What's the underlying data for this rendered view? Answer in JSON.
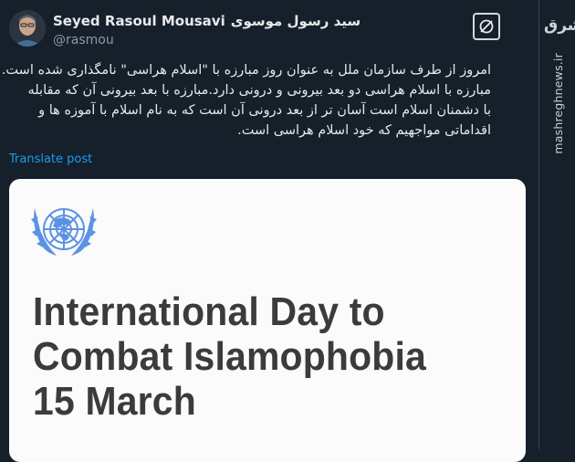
{
  "author": {
    "name_en": "Seyed Rasoul Mousavi",
    "name_fa": "سید رسول موسوی",
    "handle": "@rasmou"
  },
  "tweet": {
    "lines": [
      "امروز از طرف سازمان ملل به عنوان روز مبارزه با \"اسلام هراسی\" نامگذاری شده است.",
      "مبارزه با اسلام هراسی دو بعد بیرونی و درونی دارد.مبارزه با بعد بیرونی آن که مقابله",
      "با دشمنان اسلام است آسان تر از بعد درونی آن است که به نام اسلام با آموزه ها و",
      "اقداماتی مواجهیم که خود اسلام هراسی است."
    ],
    "translate_label": "Translate post"
  },
  "card": {
    "title_lines": [
      "International Day to",
      "Combat Islamophobia",
      "15 March"
    ],
    "logo": "un-emblem-icon",
    "un_blue": "#5b92e5"
  },
  "watermark": {
    "logo_text": "مشرق",
    "site": "mashreghnews.ir"
  },
  "colors": {
    "background": "#15202b",
    "link": "#1d9bf0",
    "text": "#e7e9ea",
    "muted": "#8b98a5"
  }
}
